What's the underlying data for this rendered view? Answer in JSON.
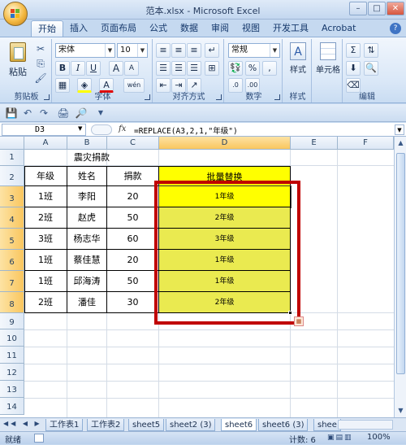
{
  "window": {
    "title": "范本.xlsx - Microsoft Excel",
    "minimize": "–",
    "maximize": "□",
    "close": "✕"
  },
  "tabs": [
    "开始",
    "插入",
    "页面布局",
    "公式",
    "数据",
    "审阅",
    "视图",
    "开发工具",
    "Acrobat"
  ],
  "ribbon": {
    "clipboard": {
      "paste": "粘贴",
      "label": "剪贴板"
    },
    "font": {
      "name": "宋体",
      "size": "10",
      "bold": "B",
      "italic": "I",
      "underline": "U",
      "grow": "A",
      "shrink": "A",
      "wen": "wén",
      "label": "字体"
    },
    "alignment": {
      "label": "对齐方式"
    },
    "number": {
      "format": "常规",
      "percent": "%",
      "comma": ",",
      "label": "数字"
    },
    "styles": {
      "style": "样式",
      "label": "样式"
    },
    "cells": {
      "cell": "单元格"
    },
    "editing": {
      "label": "编辑",
      "sum": "Σ"
    }
  },
  "formula_bar": {
    "name_box": "D3",
    "fx": "fx",
    "formula": "=REPLACE(A3,2,1,\"年级\")"
  },
  "columns": [
    "A",
    "B",
    "C",
    "D",
    "E",
    "F"
  ],
  "rows": [
    "1",
    "2",
    "3",
    "4",
    "5",
    "6",
    "7",
    "8",
    "9",
    "10",
    "11",
    "12",
    "13",
    "14"
  ],
  "table": {
    "title": "震灾捐款",
    "headers": [
      "年级",
      "姓名",
      "捐款",
      "批量替换"
    ],
    "data": [
      [
        "1班",
        "李阳",
        "20",
        "1年级"
      ],
      [
        "2班",
        "赵虎",
        "50",
        "2年级"
      ],
      [
        "3班",
        "杨志华",
        "60",
        "3年级"
      ],
      [
        "1班",
        "蔡佳慧",
        "20",
        "1年级"
      ],
      [
        "1班",
        "邱海涛",
        "50",
        "1年级"
      ],
      [
        "2班",
        "潘佳",
        "30",
        "2年级"
      ]
    ]
  },
  "sheets": [
    "工作表1",
    "工作表2",
    "sheet5",
    "sheet2 (3)",
    "sheet6",
    "sheet6 (3)",
    "shee"
  ],
  "active_sheet": "sheet6",
  "status": {
    "mode": "就绪",
    "count": "计数: 6",
    "zoom": "100%"
  },
  "colors": {
    "highlight_yellow": "#ffff00",
    "fill_yellow": "#eaea50",
    "annotation_red": "#c00000"
  }
}
